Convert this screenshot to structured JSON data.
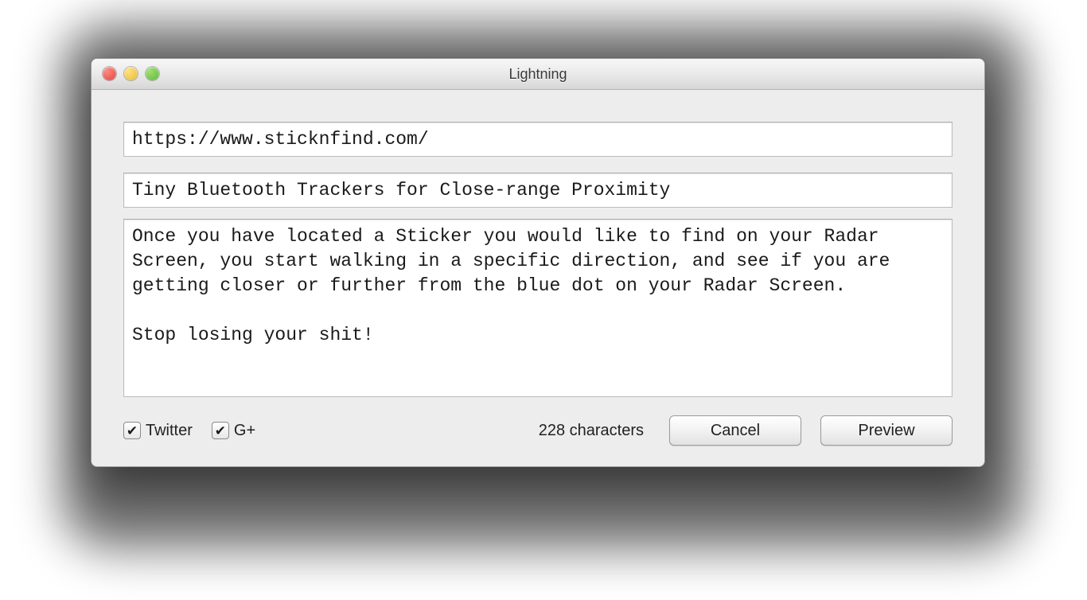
{
  "window": {
    "title": "Lightning"
  },
  "fields": {
    "url": "https://www.sticknfind.com/",
    "title": "Tiny Bluetooth Trackers for Close-range Proximity",
    "body": "Once you have located a Sticker you would like to find on your Radar Screen, you start walking in a specific direction, and see if you are getting closer or further from the blue dot on your Radar Screen.\n\nStop losing your shit!"
  },
  "footer": {
    "twitter_label": "Twitter",
    "twitter_checked": true,
    "gplus_label": "G+",
    "gplus_checked": true,
    "char_count": "228 characters",
    "cancel_label": "Cancel",
    "preview_label": "Preview"
  }
}
